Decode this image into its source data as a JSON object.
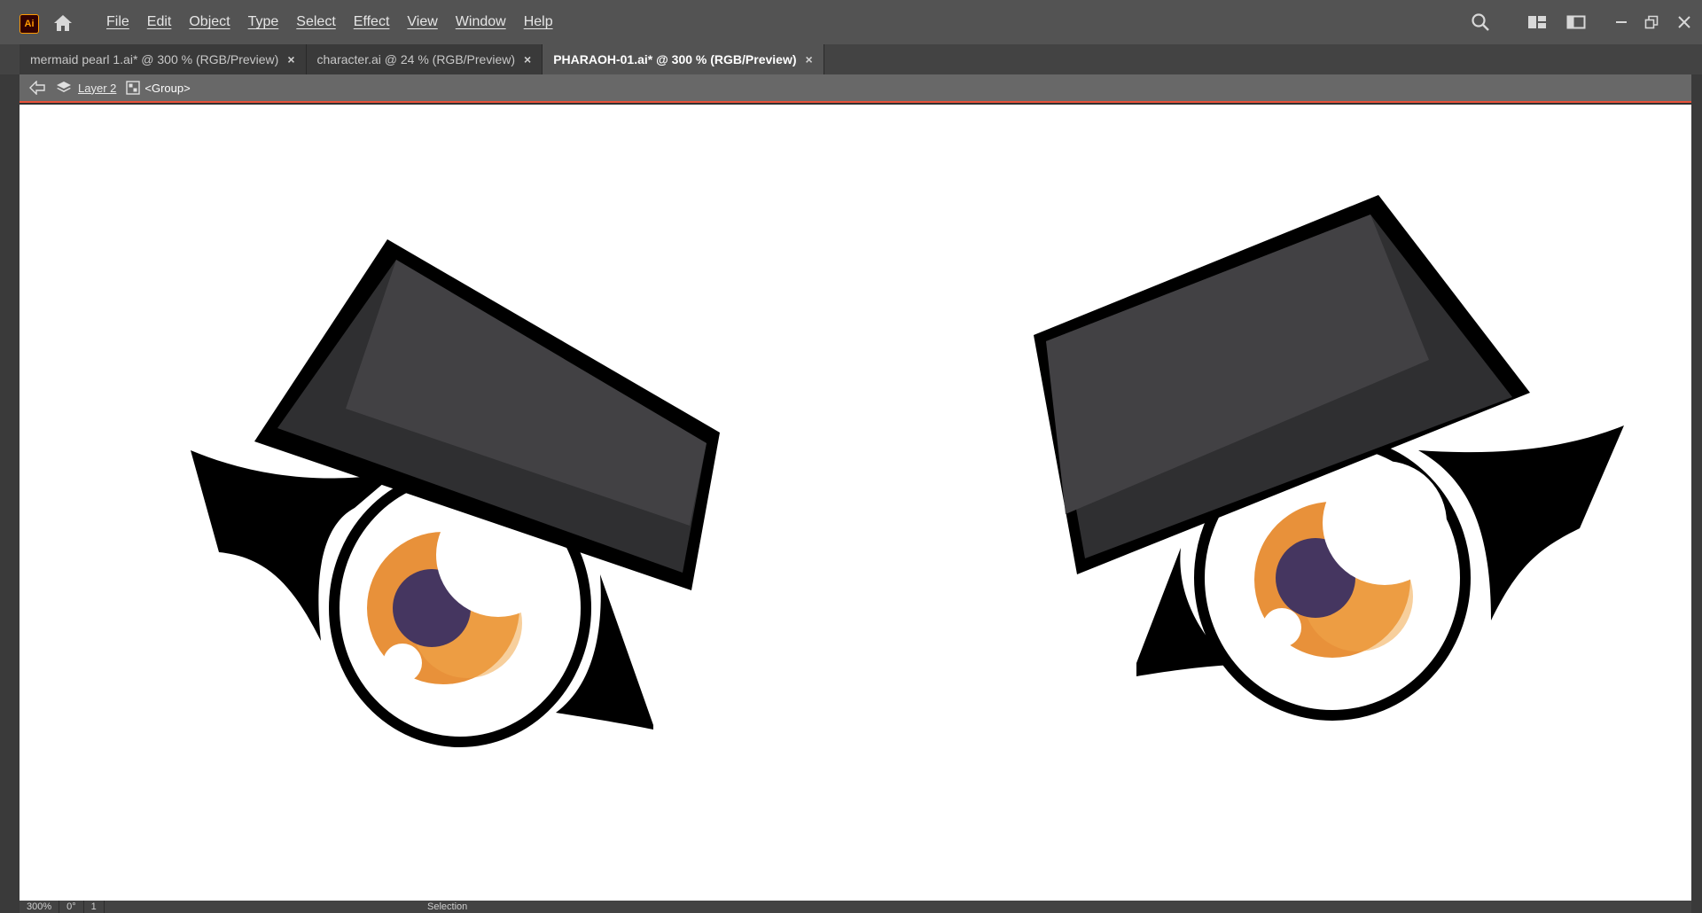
{
  "app": {
    "logo_text": "Ai",
    "accent": "#ff9a00"
  },
  "menu": {
    "items": [
      "File",
      "Edit",
      "Object",
      "Type",
      "Select",
      "Effect",
      "View",
      "Window",
      "Help"
    ]
  },
  "window_controls": {
    "icons": [
      "search-icon",
      "arrange-documents-icon",
      "workspace-icon",
      "minimize-icon",
      "restore-icon",
      "close-icon"
    ]
  },
  "tabs": [
    {
      "label": "mermaid pearl 1.ai* @ 300 % (RGB/Preview)",
      "close": "×",
      "active": false
    },
    {
      "label": "character.ai @ 24 % (RGB/Preview)",
      "close": "×",
      "active": false
    },
    {
      "label": "PHARAOH-01.ai* @ 300 % (RGB/Preview)",
      "close": "×",
      "active": true
    }
  ],
  "breadcrumb": {
    "layer": "Layer 2",
    "group": "<Group>",
    "isolation_color": "#e8523a"
  },
  "status": {
    "zoom": "300%",
    "rotation": "0°",
    "artboard": "1",
    "tool": "Selection"
  },
  "artwork": {
    "colors": {
      "outline": "#000000",
      "brow_light": "#424144",
      "brow_dark": "#2f2f31",
      "iris_orange": "#e8913a",
      "pupil": "#453660",
      "sclera": "#ffffff"
    }
  }
}
